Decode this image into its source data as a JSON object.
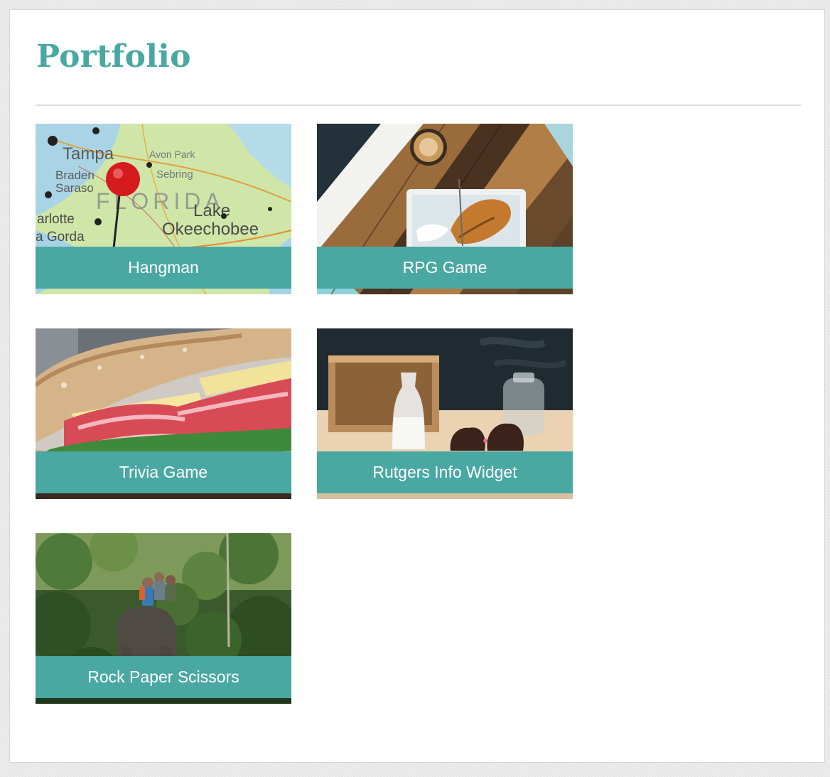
{
  "header": {
    "title": "Portfolio"
  },
  "theme": {
    "accent": "#4aa8a3",
    "background": "#e9e9e9",
    "panel": "#ffffff"
  },
  "projects": [
    {
      "label": "Hangman",
      "thumbnail": "florida-map-pin"
    },
    {
      "label": "RPG Game",
      "thumbnail": "coffee-pastry-table"
    },
    {
      "label": "Trivia Game",
      "thumbnail": "sandwich"
    },
    {
      "label": "Rutgers Info Widget",
      "thumbnail": "milk-cupcakes"
    },
    {
      "label": "Rock Paper Scissors",
      "thumbnail": "jungle-elephant-trek"
    }
  ]
}
